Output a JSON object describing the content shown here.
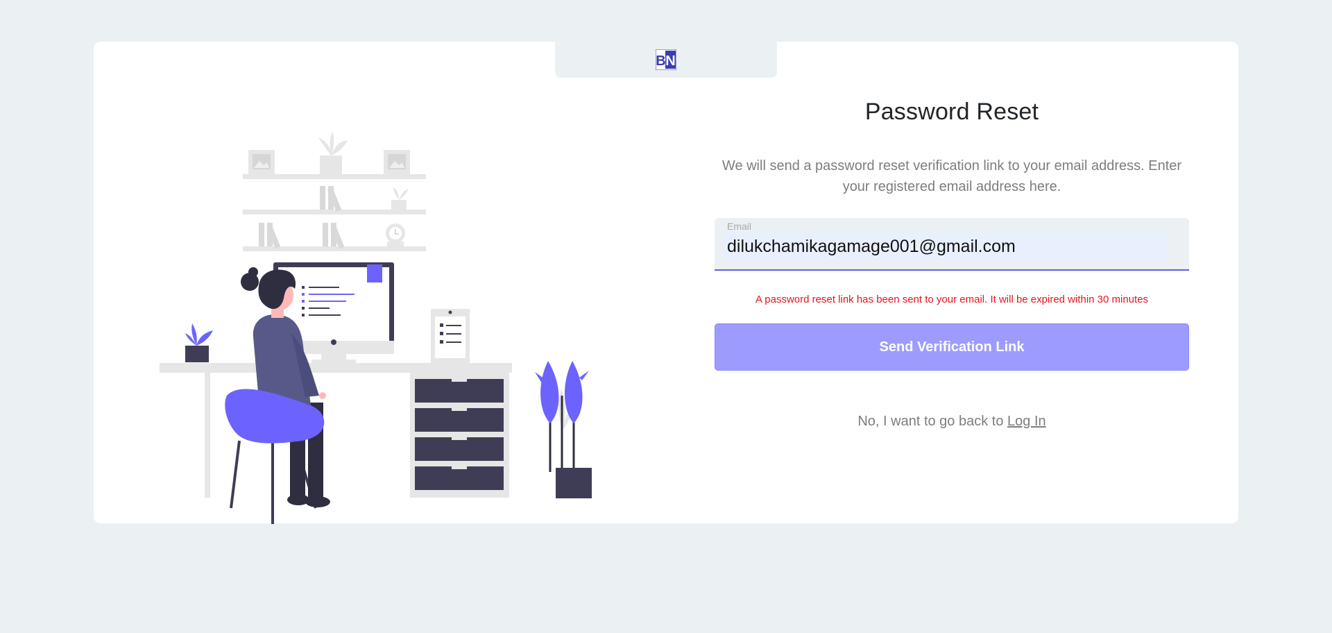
{
  "logo": {
    "text_left": "B",
    "text_right": "N",
    "color": "#3a3dad"
  },
  "form": {
    "title": "Password Reset",
    "description": "We will send a password reset verification link to your email address. Enter your registered email address here.",
    "email_label": "Email",
    "email_value": "dilukchamikagamage001@gmail.com",
    "status_message": "A password reset link has been sent to your email. It will be expired within 30 minutes",
    "submit_label": "Send Verification Link",
    "back_text": "No, I want to go back to",
    "back_link": "Log In"
  },
  "colors": {
    "accent": "#6c63ff",
    "button": "#9e9bff",
    "error": "#e8131b",
    "page_bg": "#ebf0f3"
  },
  "illustration": {
    "icon": "person-at-desk-illustration"
  }
}
